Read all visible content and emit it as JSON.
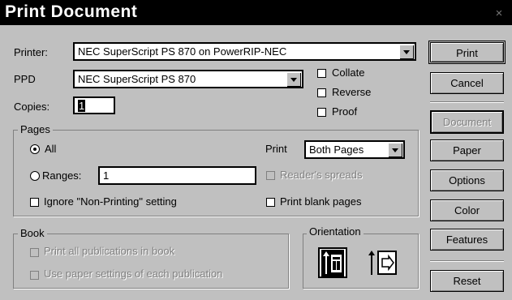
{
  "window": {
    "title": "Print Document",
    "close_glyph": "×"
  },
  "printer": {
    "label": "Printer:",
    "value": "NEC SuperScript PS 870 on PowerRIP-NEC"
  },
  "ppd": {
    "label": "PPD",
    "value": "NEC SuperScript PS 870"
  },
  "copies": {
    "label": "Copies:",
    "value": "1"
  },
  "options": {
    "collate": {
      "label": "Collate",
      "checked": false
    },
    "reverse": {
      "label": "Reverse",
      "checked": false
    },
    "proof": {
      "label": "Proof",
      "checked": false
    }
  },
  "pages": {
    "group_label": "Pages",
    "all_label": "All",
    "all_selected": true,
    "ranges_label": "Ranges:",
    "ranges_value": "1",
    "print_label": "Print",
    "print_value": "Both Pages",
    "readers_spreads_label": "Reader's spreads",
    "ignore_nonprinting_label": "Ignore \"Non-Printing\" setting",
    "print_blank_label": "Print blank pages"
  },
  "book": {
    "group_label": "Book",
    "print_all_label": "Print all publications in book",
    "use_paper_label": "Use paper settings of each publication"
  },
  "orientation": {
    "group_label": "Orientation",
    "icons": [
      "portrait-orientation-icon",
      "landscape-orientation-icon"
    ]
  },
  "buttons": {
    "print": "Print",
    "cancel": "Cancel",
    "document": "Document",
    "paper": "Paper",
    "options": "Options",
    "color": "Color",
    "features": "Features",
    "reset": "Reset"
  }
}
